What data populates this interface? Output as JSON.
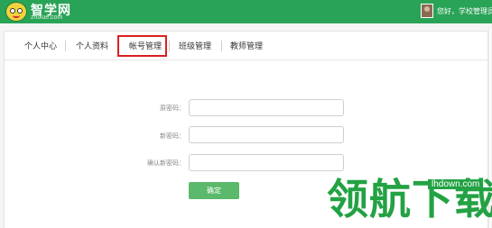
{
  "header": {
    "brand": "智学网",
    "brand_sub": "zhixue.com",
    "greeting": "您好，学校管理员！",
    "accent": "#29a356"
  },
  "tabs": [
    {
      "label": "个人中心"
    },
    {
      "label": "个人资料"
    },
    {
      "label": "帐号管理",
      "selected": true
    },
    {
      "label": "班级管理"
    },
    {
      "label": "教师管理"
    }
  ],
  "form": {
    "old_password_label": "原密码：",
    "old_password_value": "",
    "new_password_label": "新密码：",
    "new_password_value": "",
    "confirm_password_label": "确认新密码：",
    "confirm_password_value": "",
    "submit_label": "确定"
  },
  "watermark": {
    "text": "领航下载",
    "url": "lhdown.com"
  },
  "icons": {
    "logo": "mascot-logo-icon",
    "avatar": "user-avatar"
  }
}
